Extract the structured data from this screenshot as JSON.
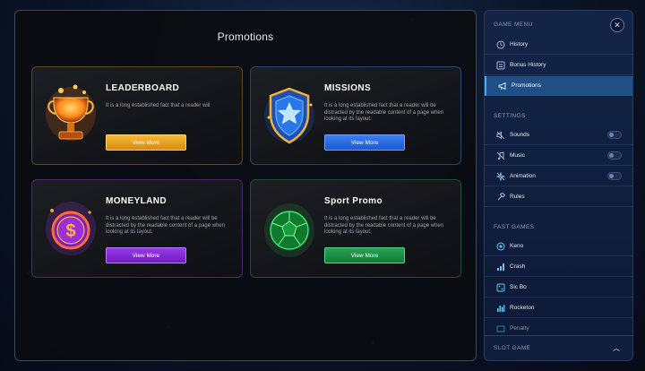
{
  "promotions": {
    "title": "Promotions",
    "cards": [
      {
        "name": "LEADERBOARD",
        "description": "It is a long established fact that a reader will",
        "button": "View More",
        "icon": "trophy-icon",
        "button_color": "#e8a21d",
        "border_color": "#5a4a1e"
      },
      {
        "name": "MISSIONS",
        "description": "It is a long established fact that a reader will be distracted by the readable content of a page when looking at its layout.",
        "button": "View More",
        "icon": "star-shield-icon",
        "button_color": "#2f6ee8",
        "border_color": "#27446e"
      },
      {
        "name": "MONEYLAND",
        "description": "It is a long established fact that a reader will be distracted by the readable content of a page when looking at its layout.",
        "button": "View More",
        "icon": "coin-icon",
        "button_color": "#8a2fd6",
        "border_color": "#4a2a6a"
      },
      {
        "name": "Sport Promo",
        "description": "It is a long established fact that a reader will be distracted by the readable content of a page when looking at its layout.",
        "button": "View More",
        "icon": "soccer-ball-icon",
        "button_color": "#1c8a43",
        "border_color": "#1f4d36"
      }
    ]
  },
  "sidebar": {
    "game_menu_label": "GAME MENU",
    "close_icon": "close-icon",
    "game_menu": [
      {
        "label": "History",
        "icon": "history-icon"
      },
      {
        "label": "Bonus History",
        "icon": "bonus-history-icon"
      },
      {
        "label": "Promotions",
        "icon": "megaphone-icon",
        "active": true
      }
    ],
    "settings_label": "SETTINGS",
    "settings": [
      {
        "label": "Sounds",
        "icon": "sound-muted-icon",
        "toggle": "off"
      },
      {
        "label": "Music",
        "icon": "music-muted-icon",
        "toggle": "off"
      },
      {
        "label": "Animation",
        "icon": "animation-off-icon",
        "toggle": "off"
      },
      {
        "label": "Rules",
        "icon": "rules-icon"
      }
    ],
    "fast_games_label": "FAST GAMES",
    "fast_games": [
      {
        "label": "Keno",
        "icon": "keno-icon"
      },
      {
        "label": "Crash",
        "icon": "crash-icon"
      },
      {
        "label": "Sic Bo",
        "icon": "sic-bo-icon"
      },
      {
        "label": "Rocketon",
        "icon": "rocketon-icon"
      },
      {
        "label": "Penalty",
        "icon": "penalty-icon"
      }
    ],
    "slot_game_label": "SLOT GAME",
    "accent_color": "#3fb2ff"
  }
}
